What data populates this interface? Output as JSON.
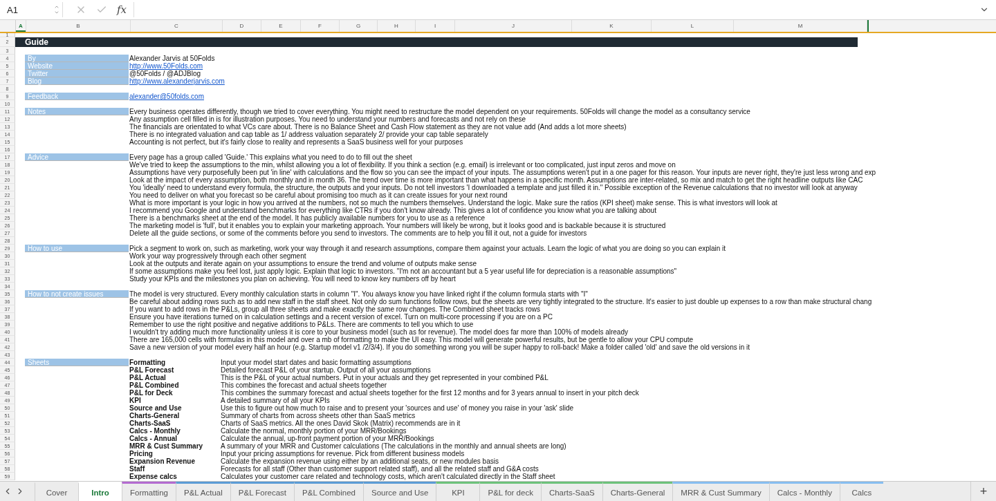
{
  "formula_bar": {
    "cell_ref": "A1",
    "fx": "fx"
  },
  "columns": [
    {
      "label": "A",
      "selected": true
    },
    {
      "label": "B",
      "selected": false
    },
    {
      "label": "C",
      "selected": false
    },
    {
      "label": "D",
      "selected": false
    },
    {
      "label": "E",
      "selected": false
    },
    {
      "label": "F",
      "selected": false
    },
    {
      "label": "G",
      "selected": false
    },
    {
      "label": "H",
      "selected": false
    },
    {
      "label": "I",
      "selected": false
    },
    {
      "label": "J",
      "selected": false
    },
    {
      "label": "K",
      "selected": false
    },
    {
      "label": "L",
      "selected": false
    },
    {
      "label": "M",
      "selected": false
    }
  ],
  "rows": [
    {
      "n": "1",
      "kind": "blank"
    },
    {
      "n": "2",
      "kind": "title",
      "title": "Guide"
    },
    {
      "n": "3",
      "kind": "blank"
    },
    {
      "n": "4",
      "kind": "info",
      "label": "By",
      "text": "Alexander Jarvis at 50Folds",
      "link": false
    },
    {
      "n": "5",
      "kind": "info",
      "label": "Website",
      "text": "http://www.50Folds.com",
      "link": true
    },
    {
      "n": "6",
      "kind": "info",
      "label": "Twitter",
      "text": "@50Folds / @ADJBlog",
      "link": false
    },
    {
      "n": "7",
      "kind": "info",
      "label": "Blog",
      "text": "http://www.alexanderjarvis.com",
      "link": true
    },
    {
      "n": "8",
      "kind": "blank"
    },
    {
      "n": "9",
      "kind": "info",
      "label": "Feedback",
      "text": "alexander@50folds.com",
      "link": true
    },
    {
      "n": "10",
      "kind": "blank"
    },
    {
      "n": "11",
      "kind": "line",
      "label": "Notes",
      "text": "Every business operates differently, though we tried to cover everything. You might need to restructure the model dependent on your requirements. 50Folds will change the model as a consultancy service"
    },
    {
      "n": "12",
      "kind": "line",
      "text": "Any assumption cell filled in is for illustration purposes. You need to understand your numbers and forecasts and not rely on these"
    },
    {
      "n": "13",
      "kind": "line",
      "text": "The financials are orientated to what VCs care about. There is no Balance Sheet and Cash Flow statement as they are not value add (And adds a lot more sheets)"
    },
    {
      "n": "14",
      "kind": "line",
      "text": "There is no integrated valuation and cap table as 1/ address valuation separately 2/ provide your cap table separately"
    },
    {
      "n": "15",
      "kind": "line",
      "text": "Accounting is not perfect, but it's fairly close to reality and represents a SaaS business well for your purposes"
    },
    {
      "n": "16",
      "kind": "blank"
    },
    {
      "n": "17",
      "kind": "line",
      "label": "Advice",
      "text": "Every page has a group called 'Guide.' This explains what you need to do to fill out the sheet"
    },
    {
      "n": "18",
      "kind": "line",
      "text": "We've tried to keep the assumptions to the min, whilst allowing you a lot of flexibility. If you think a section (e.g. email) is irrelevant or too complicated, just input zeros and move on"
    },
    {
      "n": "19",
      "kind": "line",
      "text": "Assumptions have very purposefully been put 'in line' with calculations and the flow so you can see the impact of your inputs. The assumptions weren't put in a one pager for this reason. Your inputs are never right, they're just less wrong and exp"
    },
    {
      "n": "20",
      "kind": "line",
      "text": "Look at the impact of every assumption, both monthly and in month 36. The trend over time is more important than what happens in a specific month. Assumptions are inter-related, so mix and match to get the right headline outputs like CAC"
    },
    {
      "n": "21",
      "kind": "line",
      "text": "You 'ideally' need to understand every formula, the structure, the outputs and your inputs. Do not tell investors 'I downloaded a template and just filled it in.\" Possible exception of the Revenue calculations that no investor will look at anyway"
    },
    {
      "n": "22",
      "kind": "line",
      "text": "You need to deliver on what you forecast so be careful about promising too much as it can create issues for your next round"
    },
    {
      "n": "23",
      "kind": "line",
      "text": "What is more important is your logic in how you arrived at the numbers, not so much the numbers themselves. Understand the logic. Make sure the ratios (KPI sheet) make sense. This is what investors will look at"
    },
    {
      "n": "24",
      "kind": "line",
      "text": "I recommend you Google and understand benchmarks for everything like CTRs if you don't know already. This gives a lot of confidence you know what you are talking about"
    },
    {
      "n": "25",
      "kind": "line",
      "text": "There is a benchmarks sheet at the end of the model. It has publicly available numbers for you to use as a reference"
    },
    {
      "n": "26",
      "kind": "line",
      "text": "The marketing model is 'full', but it enables you to explain your marketing approach. Your numbers will likely be wrong, but it looks good and is backable because it is structured"
    },
    {
      "n": "27",
      "kind": "line",
      "text": "Delete all the guide sections, or some of the comments before you send to investors. The comments are to help you fill it out, not a guide for investors"
    },
    {
      "n": "28",
      "kind": "blank"
    },
    {
      "n": "29",
      "kind": "line",
      "label": "How to use",
      "text": "Pick a segment to work on, such as marketing, work your way through it and research assumptions, compare them against your actuals. Learn the logic of what you are doing so you can explain it"
    },
    {
      "n": "30",
      "kind": "line",
      "text": "Work your way progressively through each other segment"
    },
    {
      "n": "31",
      "kind": "line",
      "text": "Look at the outputs and iterate again on your assumptions to ensure the trend and volume of outputs make sense"
    },
    {
      "n": "32",
      "kind": "line",
      "text": "If some assumptions make you feel lost, just apply logic. Explain that logic to investors. \"I'm not an accountant but a 5 year useful life for depreciation is a reasonable assumptions\""
    },
    {
      "n": "33",
      "kind": "line",
      "text": "Study your KPIs and the milestones you plan on achieving. You will need to know key numbers off by heart"
    },
    {
      "n": "34",
      "kind": "blank"
    },
    {
      "n": "35",
      "kind": "line",
      "label": "How to not create issues",
      "text": "The model is very structured. Every monthly calculation starts in column \"I\". You always know you have linked right if the column formula starts with \"I\""
    },
    {
      "n": "36",
      "kind": "line",
      "text": "Be careful about adding rows such as to add new staff in the staff sheet. Not only do sum functions follow rows, but the sheets are very tightly integrated to the structure. It's easier to just double up expenses to a row than make structural chang"
    },
    {
      "n": "37",
      "kind": "line",
      "text": "If you want to add rows in the P&Ls, group all three sheets and make exactly the same row changes. The Combined sheet tracks rows"
    },
    {
      "n": "38",
      "kind": "line",
      "text": "Ensure you have iterations turned on in calculation settings and a recent version of excel. Turn on multi-core processing if you are on a PC"
    },
    {
      "n": "39",
      "kind": "line",
      "text": "Remember to use the right positive and negative additions to P&Ls. There are comments to tell you which to use"
    },
    {
      "n": "40",
      "kind": "line",
      "text": "I wouldn't try adding much more functionality unless it is core to your business model (such as for revenue). The model does far more than 100% of models already"
    },
    {
      "n": "41",
      "kind": "line",
      "text": "There are 165,000 cells with formulas in this model and over a mb of formatting to make the UI easy. This model will generate powerful results, but be gentle to allow your CPU compute"
    },
    {
      "n": "42",
      "kind": "line",
      "text": "Save a new version of your model every half an hour (e.g. Startup model v1 /2/3/4). If you do something wrong you will be super happy to roll-back! Make a folder called 'old' and save the old versions in it"
    },
    {
      "n": "43",
      "kind": "blank"
    },
    {
      "n": "44",
      "kind": "sheet",
      "label": "Sheets",
      "name": "Formatting",
      "text": "Input your model start dates and basic formatting assumptions"
    },
    {
      "n": "45",
      "kind": "sheet",
      "name": "P&L Forecast",
      "text": "Detailed forecast P&L of your startup. Output of all your assumptions"
    },
    {
      "n": "46",
      "kind": "sheet",
      "name": "P&L Actual",
      "text": "This is the P&L of your actual numbers. Put in your actuals and they get represented in your combined P&L"
    },
    {
      "n": "47",
      "kind": "sheet",
      "name": "P&L Combined",
      "text": "This combines the forecast and actual sheets together"
    },
    {
      "n": "48",
      "kind": "sheet",
      "name": "P&L for Deck",
      "text": "This combines the summary forecast and actual sheets together for the first 12 months and for 3 years annual to insert in your pitch deck"
    },
    {
      "n": "49",
      "kind": "sheet",
      "name": "KPI",
      "text": "A detailed summary of all your KPIs"
    },
    {
      "n": "50",
      "kind": "sheet",
      "name": "Source and Use",
      "text": "Use this to figure out how much to raise and to present your 'sources and use' of money you raise in your 'ask' slide"
    },
    {
      "n": "51",
      "kind": "sheet",
      "name": "Charts-General",
      "text": "Summary of charts from across sheets other than SaaS metrics"
    },
    {
      "n": "52",
      "kind": "sheet",
      "name": "Charts-SaaS",
      "text": "Charts of SaaS metrics. All the ones David Skok (Matrix) recommends are in it"
    },
    {
      "n": "53",
      "kind": "sheet",
      "name": "Calcs - Monthly",
      "text": "Calculate the normal, monthly portion of your MRR/Bookings"
    },
    {
      "n": "54",
      "kind": "sheet",
      "name": "Calcs - Annual",
      "text": "Calculate the annual, up-front payment portion of your MRR/Bookings"
    },
    {
      "n": "55",
      "kind": "sheet",
      "name": "MRR & Cust Summary",
      "text": "A summary of your MRR and Customer calculations (The calculations in the monthly and annual sheets are long)"
    },
    {
      "n": "56",
      "kind": "sheet",
      "name": "Pricing",
      "text": "Input your pricing assumptions for revenue. Pick from different business models"
    },
    {
      "n": "57",
      "kind": "sheet",
      "name": "Expansion Revenue",
      "text": "Calculate the expansion revenue using either by an additional seats, or new modules basis"
    },
    {
      "n": "58",
      "kind": "sheet",
      "name": "Staff",
      "text": "Forecasts for all staff (Other than customer support related staff), and all the related staff and G&A costs"
    },
    {
      "n": "59",
      "kind": "sheet",
      "name": "Expense calcs",
      "text": "Calculates your customer care related and technology costs, which aren't calculated directly in the Staff sheet"
    }
  ],
  "tabs": [
    {
      "label": "Cover",
      "selected": false
    },
    {
      "label": "Intro",
      "selected": true
    },
    {
      "label": "Formatting",
      "selected": false,
      "color": "#b36ad0"
    },
    {
      "label": "P&L Actual",
      "selected": false,
      "color": "#5b9bd5"
    },
    {
      "label": "P&L Forecast",
      "selected": false,
      "color": "#5b9bd5"
    },
    {
      "label": "P&L Combined",
      "selected": false,
      "color": "#5b9bd5"
    },
    {
      "label": "Source and Use",
      "selected": false,
      "color": "#5b9bd5"
    },
    {
      "label": "KPI",
      "selected": false,
      "color": "#6cc17a"
    },
    {
      "label": "P&L for deck",
      "selected": false,
      "color": "#6cc17a"
    },
    {
      "label": "Charts-SaaS",
      "selected": false,
      "color": "#6cc17a"
    },
    {
      "label": "Charts-General",
      "selected": false,
      "color": "#6cc17a"
    },
    {
      "label": "MRR & Cust Summary",
      "selected": false,
      "color": "#86bdf0"
    },
    {
      "label": "Calcs - Monthly",
      "selected": false,
      "color": "#86bdf0"
    },
    {
      "label": "Calcs",
      "selected": false,
      "color": "#86bdf0"
    }
  ],
  "add_sheet": "+"
}
